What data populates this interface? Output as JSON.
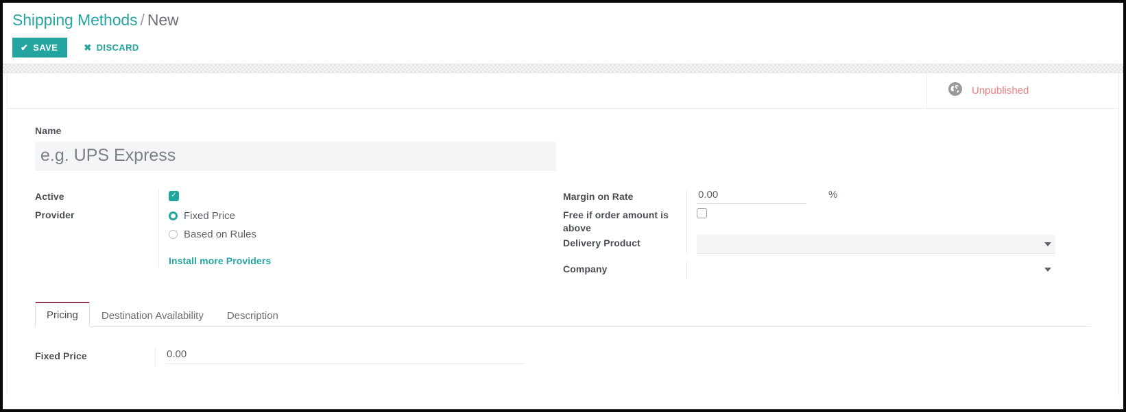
{
  "breadcrumb": {
    "root": "Shipping Methods",
    "separator": "/",
    "current": "New"
  },
  "toolbar": {
    "save_label": "SAVE",
    "save_icon": "check-icon",
    "discard_label": "DISCARD",
    "discard_icon": "times-icon"
  },
  "status": {
    "icon": "globe-icon",
    "label": "Unpublished",
    "color": "#f08080"
  },
  "theme": {
    "accent": "#23a49e",
    "tab_active_border": "#8e3b52",
    "label_color": "#4a4f55"
  },
  "form": {
    "name": {
      "label": "Name",
      "value": "",
      "placeholder": "e.g. UPS Express"
    },
    "left": {
      "active": {
        "label": "Active",
        "checked": true
      },
      "provider": {
        "label": "Provider",
        "options": [
          {
            "label": "Fixed Price",
            "selected": true
          },
          {
            "label": "Based on Rules",
            "selected": false
          }
        ],
        "install_link": "Install more Providers"
      }
    },
    "right": {
      "margin_on_rate": {
        "label": "Margin on Rate",
        "value": "0.00",
        "suffix": "%"
      },
      "free_if_order_amount_is_above": {
        "label": "Free if order amount is above",
        "checked": false
      },
      "delivery_product": {
        "label": "Delivery Product",
        "value": "",
        "caret": "chevron-down-icon"
      },
      "company": {
        "label": "Company",
        "value": "",
        "caret": "chevron-down-icon"
      }
    }
  },
  "notebook": {
    "tabs": [
      {
        "label": "Pricing",
        "active": true
      },
      {
        "label": "Destination Availability",
        "active": false
      },
      {
        "label": "Description",
        "active": false
      }
    ],
    "pricing": {
      "fixed_price": {
        "label": "Fixed Price",
        "value": "0.00"
      }
    }
  }
}
